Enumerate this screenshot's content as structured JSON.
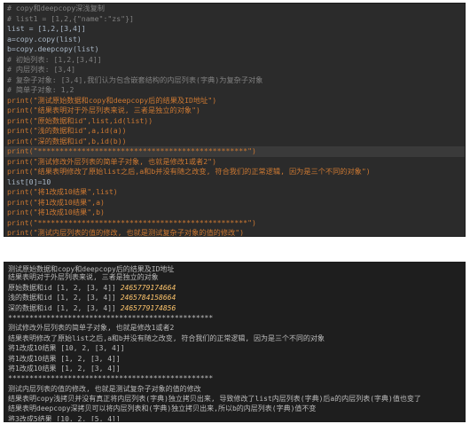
{
  "editor": {
    "lines": [
      {
        "cls": "c-comment",
        "text": "# copy和deepcopy深浅复制"
      },
      {
        "cls": "c-comment",
        "text": "# list1 = [1,2,{\"name\":\"zs\"}]"
      },
      {
        "cls": "c-var",
        "text": "list = [1,2,[3,4]]"
      },
      {
        "cls": "c-var",
        "text": "a=copy.copy(list)"
      },
      {
        "cls": "c-var",
        "text": "b=copy.deepcopy(list)"
      },
      {
        "cls": "c-comment",
        "text": "# 初始列表: [1,2,[3,4]]"
      },
      {
        "cls": "c-comment",
        "text": "# 内层列表: [3,4]"
      },
      {
        "cls": "c-comment",
        "text": "# 复杂子对象: [3,4],我们认为包含嵌套结构的内层列表(字典)为复杂子对象"
      },
      {
        "cls": "c-comment",
        "text": "# 简单子对象: 1,2"
      },
      {
        "cls": "c-print",
        "text": "print(\"测试原始数据和copy和deepcopy后的结果及ID地址\")"
      },
      {
        "cls": "c-print",
        "text": "print(\"结果表明对于外层列表来说, 三者是独立的对象\")"
      },
      {
        "cls": "c-print",
        "text": "print(\"原始数据和id\",list,id(list))"
      },
      {
        "cls": "c-print",
        "text": "print(\"浅的数据和id\",a,id(a))"
      },
      {
        "cls": "c-print",
        "text": "print(\"深的数据和id\",b,id(b))"
      },
      {
        "cls": "c-print",
        "text": "print(\"************************************************\")",
        "hl": true
      },
      {
        "cls": "c-print",
        "text": "print(\"测试修改外层列表的简单子对象, 也就是修改1或者2\")"
      },
      {
        "cls": "c-print",
        "text": "print(\"结果表明修改了原始list之后,a和b并没有随之改变, 符合我们的正常逻辑, 因为是三个不同的对象\")"
      },
      {
        "cls": "c-var",
        "text": "list[0]=10"
      },
      {
        "cls": "c-print",
        "text": "print(\"将1改成10结果\",list)"
      },
      {
        "cls": "c-print",
        "text": "print(\"将1改成10结果\",a)"
      },
      {
        "cls": "c-print",
        "text": "print(\"将1改成10结果\",b)"
      },
      {
        "cls": "c-print",
        "text": "print(\"************************************************\")"
      },
      {
        "cls": "c-print",
        "text": "print(\"测试内层列表的值的修改, 也就是测试复杂子对象的值的修改\")"
      },
      {
        "cls": "c-print",
        "text": "print(\"结果表明copy浅拷贝并没有真正将内层列表(字典)独立拷贝出来, 导致修改了list内层列表(字典)后a的内层列表(字典)值也变了\")"
      },
      {
        "cls": "c-print",
        "text": "print(\"结果表明deepcopy深拷贝可以将内层列表和(字典)独立拷贝出来,所以b的内层列表(字典)值不变\")"
      },
      {
        "cls": "c-var",
        "text": "list[2][0]=5"
      },
      {
        "cls": "c-print",
        "text": "print(\"将3改成5结果\",list)"
      },
      {
        "cls": "c-print",
        "text": "print(\"将3改成5结果\",a)"
      },
      {
        "cls": "c-print",
        "text": "print(\"将3改成5结果\",b)"
      }
    ]
  },
  "console": {
    "lines": [
      {
        "text": "测试原始数据和copy和deepcopy后的结果及ID地址"
      },
      {
        "text": "结果表明对于外层列表来说, 三者是独立的对象"
      },
      {
        "text": "原始数据和id [1, 2, [3, 4]] ",
        "addr": "2465779174664"
      },
      {
        "text": "浅的数据和id [1, 2, [3, 4]] ",
        "addr": "2465784158664"
      },
      {
        "text": "深的数据和id [1, 2, [3, 4]] ",
        "addr": "2465779174856"
      },
      {
        "text": "************************************************"
      },
      {
        "text": "测试修改外层列表的简单子对象, 也就是修改1或者2"
      },
      {
        "text": "结果表明修改了原始list之后,a和b并没有随之改变, 符合我们的正常逻辑, 因为是三个不同的对象"
      },
      {
        "text": "将1改成10结果 [10, 2, [3, 4]]"
      },
      {
        "text": "将1改成10结果 [1, 2, [3, 4]]"
      },
      {
        "text": "将1改成10结果 [1, 2, [3, 4]]"
      },
      {
        "text": "************************************************"
      },
      {
        "text": "测试内层列表的值的修改, 也就是测试复杂子对象的值的修改"
      },
      {
        "text": "结果表明copy浅拷贝并没有真正将内层列表(字典)独立拷贝出来, 导致修改了list内层列表(字典)后a的内层列表(字典)值也变了"
      },
      {
        "text": "结果表明deepcopy深拷贝可以将内层列表和(字典)独立拷贝出来,所以b的内层列表(字典)值不变"
      },
      {
        "text": "将3改成5结果 [10, 2, [5, 4]]"
      },
      {
        "text": "将3改成5结果 [1, 2, [5, 4]]"
      },
      {
        "text": "将3改成5结果 [1, 2, [3, 4]]"
      }
    ]
  }
}
